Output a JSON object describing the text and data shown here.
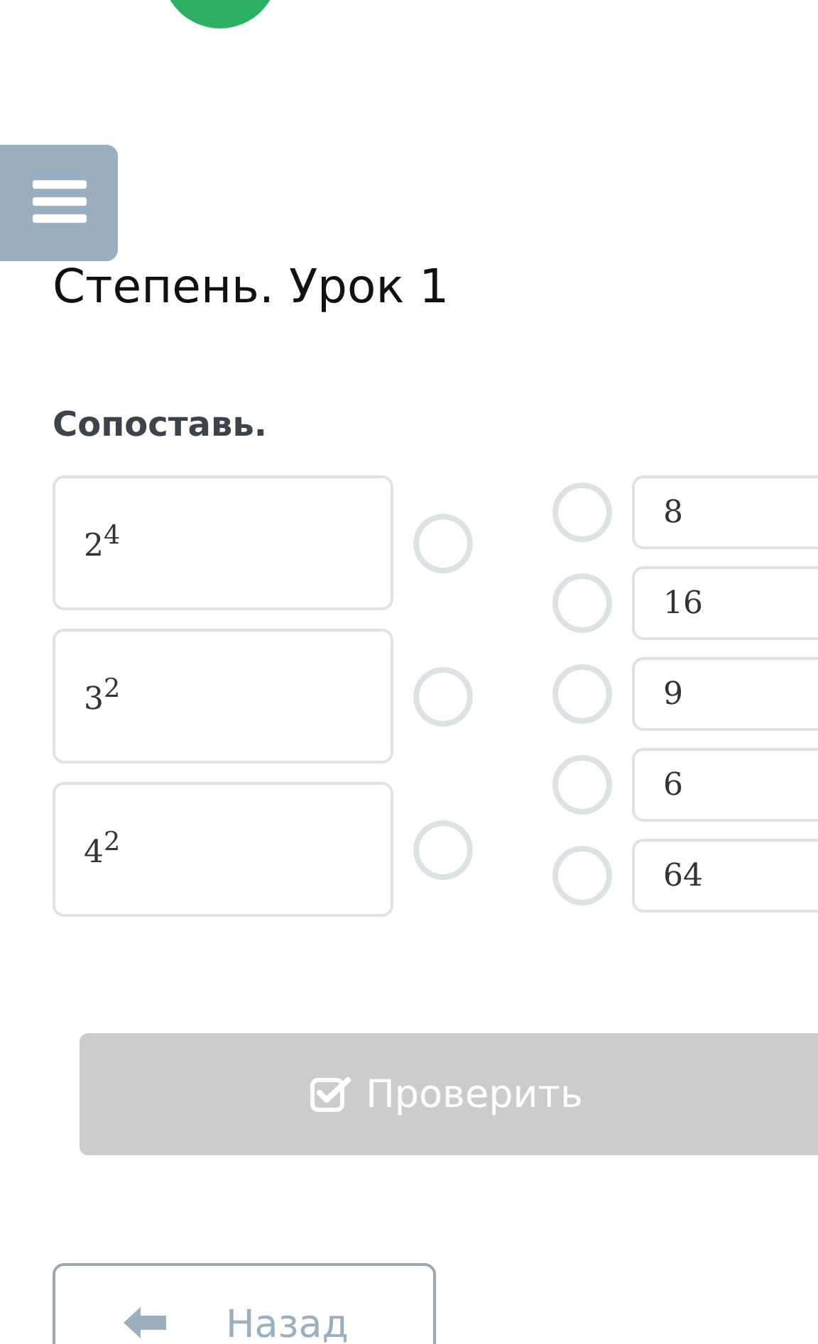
{
  "title": "Степень. Урок 1",
  "task": "Сопоставь.",
  "left_items": [
    {
      "text": "2$^{4}$"
    },
    {
      "text": "3$^{2}$"
    },
    {
      "text": "4$^{2}$"
    }
  ],
  "right_items": [
    {
      "text": "8"
    },
    {
      "text": "16"
    },
    {
      "text": "9"
    },
    {
      "text": "6"
    },
    {
      "text": "64"
    }
  ],
  "check_button": {
    "label": "Проверить",
    "disabled": true
  },
  "back_button": {
    "label": "Назад"
  }
}
